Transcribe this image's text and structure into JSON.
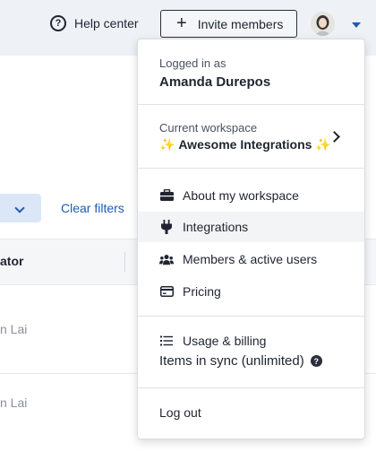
{
  "header": {
    "help_center": "Help center",
    "invite_members": "Invite members",
    "help_icon_glyph": "?",
    "plus_glyph": "+"
  },
  "background": {
    "clear_filters": "Clear filters",
    "column_header": "ator",
    "rows": [
      "n Lai",
      "n Lai"
    ]
  },
  "menu": {
    "logged_in_label": "Logged in as",
    "user_name": "Amanda Durepos",
    "current_workspace_label": "Current workspace",
    "workspace_sparkle": "✨",
    "workspace_name": "Awesome Integrations",
    "items": [
      {
        "label": "About my workspace",
        "icon": "briefcase-icon"
      },
      {
        "label": "Integrations",
        "icon": "plug-icon"
      },
      {
        "label": "Members & active users",
        "icon": "users-icon"
      },
      {
        "label": "Pricing",
        "icon": "credit-card-icon"
      }
    ],
    "usage_billing": "Usage & billing",
    "usage_icon": "list-icon",
    "items_in_sync": "Items in sync (unlimited)",
    "help_badge": "?",
    "log_out": "Log out"
  },
  "colors": {
    "accent": "#1f5bb5",
    "header_bg": "#eef2f7",
    "hover_bg": "#f3f4f6"
  }
}
